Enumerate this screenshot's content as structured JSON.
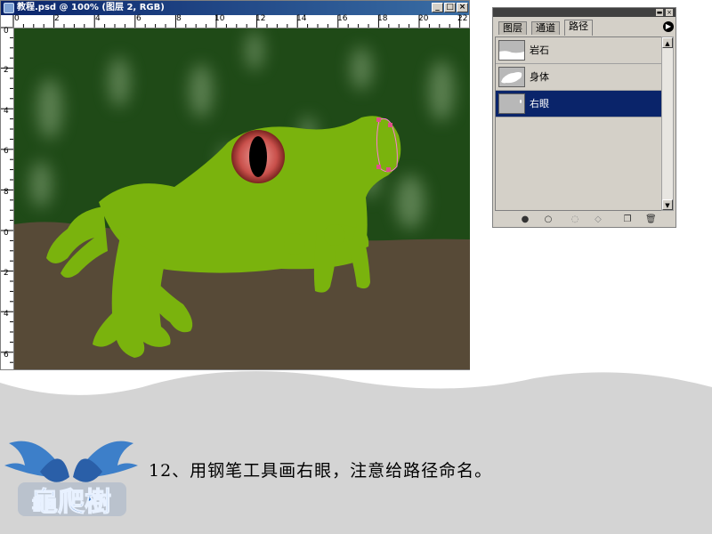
{
  "document": {
    "title": "教程.psd @ 100% (图层 2, RGB)",
    "window_buttons": [
      "_",
      "□",
      "×"
    ],
    "ruler_top_labels": [
      "0",
      "2",
      "4",
      "6",
      "8",
      "10",
      "12",
      "14",
      "16",
      "18",
      "20",
      "22"
    ],
    "ruler_left_labels": [
      "0",
      "2",
      "4",
      "6",
      "8",
      "0",
      "2",
      "4",
      "6"
    ]
  },
  "paths_panel": {
    "tabs": [
      "图层",
      "通道",
      "路径"
    ],
    "active_tab": "路径",
    "paths": [
      {
        "name": "岩石",
        "thumb": "rock-path-thumb",
        "selected": false
      },
      {
        "name": "身体",
        "thumb": "body-path-thumb",
        "selected": false
      },
      {
        "name": "右眼",
        "thumb": "right-eye-path-thumb",
        "selected": true
      }
    ],
    "footer_icons": [
      "fill-path-icon",
      "stroke-path-icon",
      "load-selection-icon",
      "make-work-path-icon",
      "new-path-icon",
      "delete-path-icon"
    ]
  },
  "caption": "12、用钢笔工具画右眼，注意给路径命名。",
  "logo_text": "龜爬樹",
  "colors": {
    "titlebar": "#0a246a",
    "selection": "#0a246a",
    "forest": "#1f4a17",
    "frog": "#7ab30d",
    "rock": "#574a37",
    "eye": "#c9504b",
    "wave": "#d4d4d4"
  }
}
